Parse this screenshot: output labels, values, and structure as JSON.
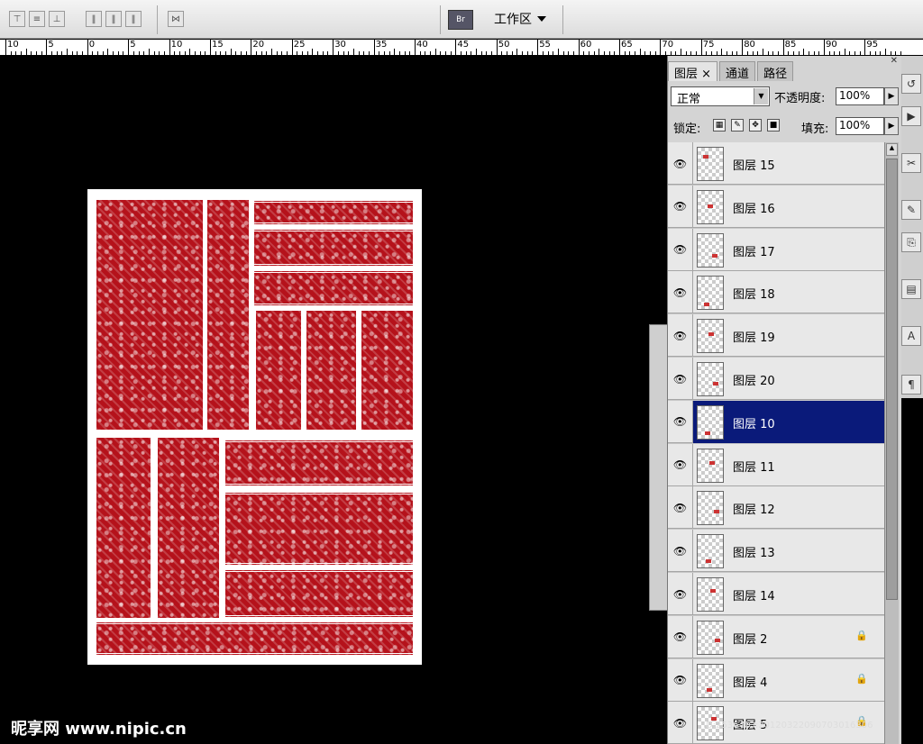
{
  "workspace": {
    "label": "工作区"
  },
  "bridge": {
    "label": "Br"
  },
  "ruler": {
    "labels": [
      "10",
      "5",
      "0",
      "5",
      "10",
      "15",
      "20",
      "25",
      "30",
      "35",
      "40",
      "45",
      "50",
      "55",
      "60",
      "65",
      "70",
      "75",
      "80",
      "85",
      "90",
      "95"
    ]
  },
  "panel": {
    "tabs": [
      "图层",
      "通道",
      "路径"
    ],
    "blend_mode": "正常",
    "opacity_label": "不透明度:",
    "opacity_value": "100%",
    "lock_label": "锁定:",
    "fill_label": "填充:",
    "fill_value": "100%",
    "layers": [
      {
        "name": "图层 15",
        "locked": false,
        "selected": false
      },
      {
        "name": "图层 16",
        "locked": false,
        "selected": false
      },
      {
        "name": "图层 17",
        "locked": false,
        "selected": false
      },
      {
        "name": "图层 18",
        "locked": false,
        "selected": false
      },
      {
        "name": "图层 19",
        "locked": false,
        "selected": false
      },
      {
        "name": "图层 20",
        "locked": false,
        "selected": false
      },
      {
        "name": "图层 10",
        "locked": false,
        "selected": true
      },
      {
        "name": "图层 11",
        "locked": false,
        "selected": false
      },
      {
        "name": "图层 12",
        "locked": false,
        "selected": false
      },
      {
        "name": "图层 13",
        "locked": false,
        "selected": false
      },
      {
        "name": "图层 14",
        "locked": false,
        "selected": false
      },
      {
        "name": "图层 2",
        "locked": true,
        "selected": false
      },
      {
        "name": "图层 4",
        "locked": true,
        "selected": false
      },
      {
        "name": "图层 5",
        "locked": true,
        "selected": false
      }
    ]
  },
  "watermark": {
    "site": "昵享网 www.nipic.cn",
    "id": "ID:2536 NO:20120322090703016306"
  },
  "colors": {
    "selected": "#0a1a7a",
    "pattern_red": "#b5121b"
  }
}
